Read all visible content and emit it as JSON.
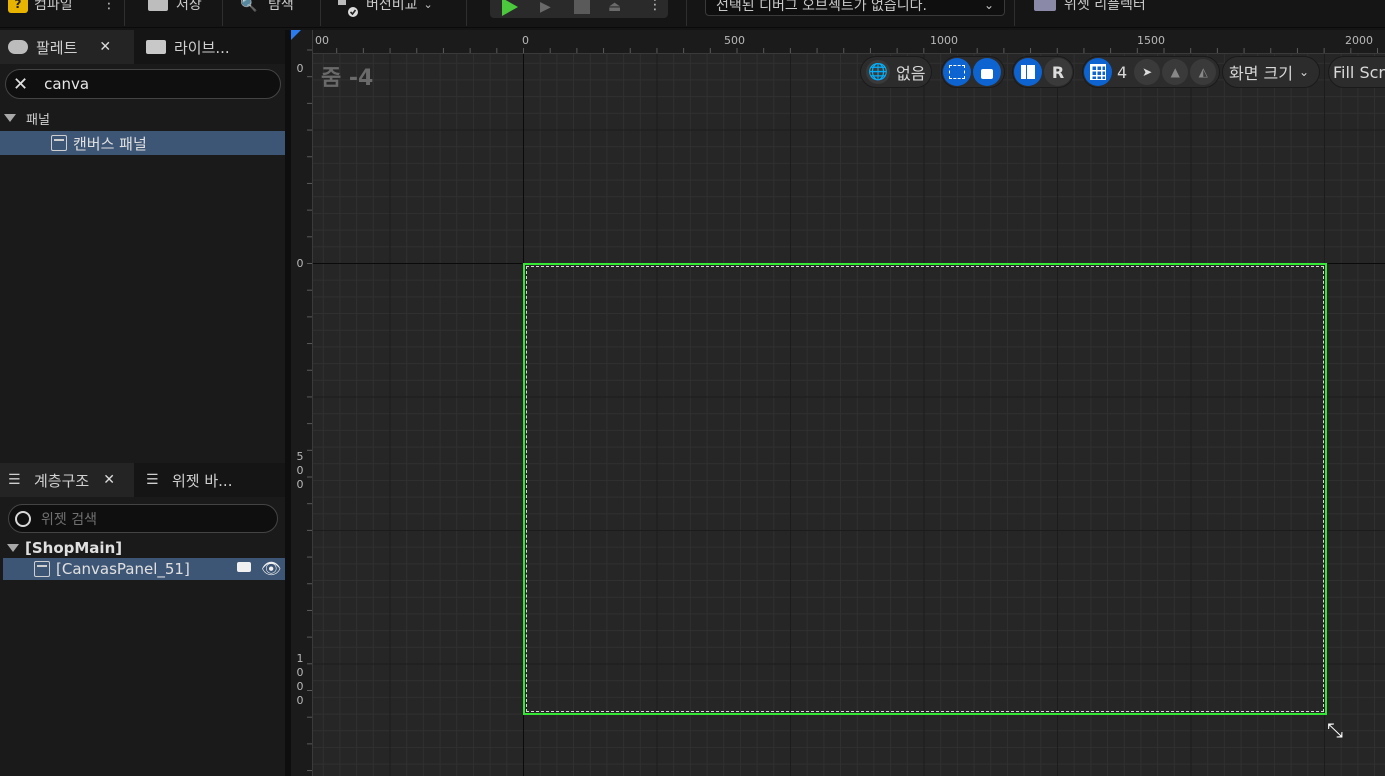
{
  "toolbar": {
    "compile_label": "컴파일",
    "save_label": "저장",
    "browse_label": "탐색",
    "diff_label": "버전비교",
    "debug_object_label": "선택된 디버그 오브젝트가 없습니다.",
    "widget_reflector_label": "위젯 리플렉터"
  },
  "palette": {
    "tab_label": "팔레트",
    "library_tab_label": "라이브...",
    "search_value": "canva",
    "category_label": "패널",
    "items": [
      {
        "label": "캔버스 패널",
        "selected": true
      }
    ]
  },
  "hierarchy": {
    "tab_label": "계층구조",
    "bindings_tab_label": "위젯 바...",
    "search_placeholder": "위젯 검색",
    "root_label": "[ShopMain]",
    "child_label": "[CanvasPanel_51]"
  },
  "designer": {
    "zoom_label": "줌 -4",
    "ruler_top": [
      "00",
      "0",
      "500",
      "1000",
      "1500",
      "2000"
    ],
    "ruler_left_top": "0",
    "ruler_left_zero": "0",
    "ruler_left_500": [
      "5",
      "0",
      "0"
    ],
    "ruler_left_1000": [
      "1",
      "0",
      "0",
      "0"
    ],
    "localization_label": "없음",
    "r_label": "R",
    "grid_value": "4",
    "screen_size_label": "화면 크기",
    "fill_screen_label": "Fill Scre",
    "canvas_border_color": "#36e636"
  }
}
